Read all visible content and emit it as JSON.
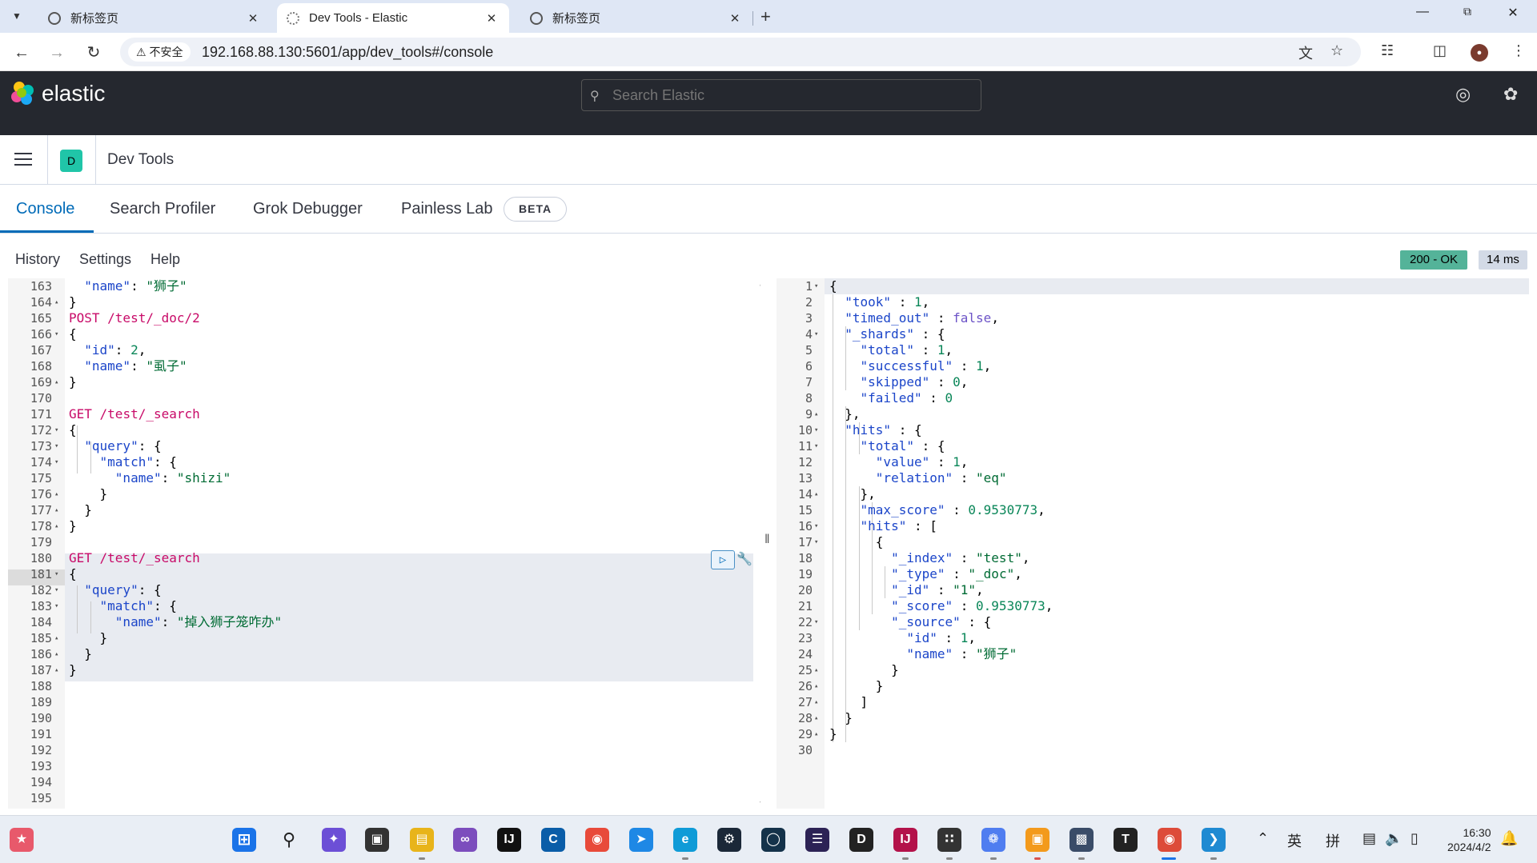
{
  "browser": {
    "tabs": [
      {
        "title": "新标签页"
      },
      {
        "title": "Dev Tools - Elastic"
      },
      {
        "title": "新标签页"
      }
    ],
    "security_label": "不安全",
    "url": "192.168.88.130:5601/app/dev_tools#/console"
  },
  "kibana": {
    "search_placeholder": "Search Elastic",
    "app_badge": "D",
    "breadcrumb": "Dev Tools",
    "logo_text": "elastic",
    "tabs": [
      "Console",
      "Search Profiler",
      "Grok Debugger",
      "Painless Lab"
    ],
    "beta_label": "BETA",
    "menu": [
      "History",
      "Settings",
      "Help"
    ],
    "status_code": "200 - OK",
    "status_time": "14 ms"
  },
  "editor_lines": [
    "163",
    "164",
    "165",
    "166",
    "167",
    "168",
    "169",
    "170",
    "171",
    "172",
    "173",
    "174",
    "175",
    "176",
    "177",
    "178",
    "179",
    "180",
    "181",
    "182",
    "183",
    "184",
    "185",
    "186",
    "187",
    "188",
    "189",
    "190",
    "191",
    "192",
    "193",
    "194",
    "195"
  ],
  "editor_text": {
    "l163k": "\"name\"",
    "l163v": "\"狮子\"",
    "l165m": "POST",
    "l165p": " /test/_doc/2",
    "l167k": "\"id\"",
    "l167v": "2",
    "l168k": "\"name\"",
    "l168v": "\"虱子\"",
    "l171m": "GET",
    "l171p": " /test/_search",
    "l173k": "\"query\"",
    "l174k": "\"match\"",
    "l175k": "\"name\"",
    "l175v": "\"shizi\"",
    "l180m": "GET",
    "l180p": " /test/_search",
    "l182k": "\"query\"",
    "l183k": "\"match\"",
    "l184k": "\"name\"",
    "l184v": "\"掉入狮子笼咋办\""
  },
  "output_lines": [
    "1",
    "2",
    "3",
    "4",
    "5",
    "6",
    "7",
    "8",
    "9",
    "10",
    "11",
    "12",
    "13",
    "14",
    "15",
    "16",
    "17",
    "18",
    "19",
    "20",
    "21",
    "22",
    "23",
    "24",
    "25",
    "26",
    "27",
    "28",
    "29",
    "30"
  ],
  "output_text": {
    "took_k": "\"took\"",
    "took_v": "1",
    "timed_out_k": "\"timed_out\"",
    "timed_out_v": "false",
    "shards_k": "\"_shards\"",
    "total_k": "\"total\"",
    "total_v": "1",
    "successful_k": "\"successful\"",
    "successful_v": "1",
    "skipped_k": "\"skipped\"",
    "skipped_v": "0",
    "failed_k": "\"failed\"",
    "failed_v": "0",
    "hits_k": "\"hits\"",
    "htotal_k": "\"total\"",
    "value_k": "\"value\"",
    "value_v": "1",
    "relation_k": "\"relation\"",
    "relation_v": "\"eq\"",
    "max_score_k": "\"max_score\"",
    "max_score_v": "0.9530773",
    "hits2_k": "\"hits\"",
    "index_k": "\"_index\"",
    "index_v": "\"test\"",
    "type_k": "\"_type\"",
    "type_v": "\"_doc\"",
    "id_k": "\"_id\"",
    "id_v": "\"1\"",
    "score_k": "\"_score\"",
    "score_v": "0.9530773",
    "source_k": "\"_source\"",
    "sid_k": "\"id\"",
    "sid_v": "1",
    "sname_k": "\"name\"",
    "sname_v": "\"狮子\""
  },
  "taskbar": {
    "ime_lang": "英",
    "ime_mode": "拼",
    "time": "16:30",
    "date": "2024/4/2"
  },
  "colors": {
    "accent": "#006bb8",
    "status_ok": "#54b399",
    "header_bg": "#25282f",
    "method": "#c80a68",
    "key": "#1b45c9",
    "string": "#006b34"
  }
}
